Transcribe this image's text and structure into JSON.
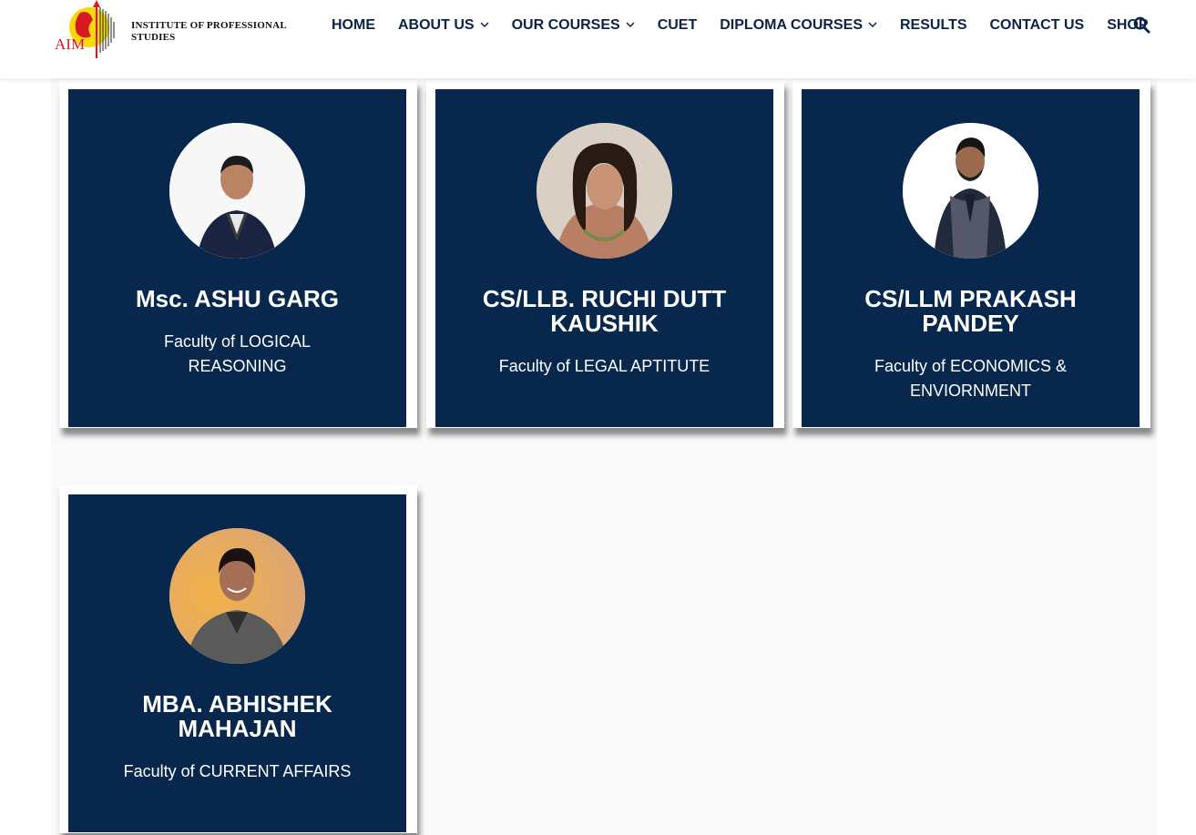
{
  "brand": {
    "logo_text": "AIM",
    "name_line1": "INSTITUTE OF PROFESSIONAL",
    "name_line2": "STUDIES"
  },
  "nav": {
    "items": [
      {
        "label": "HOME",
        "has_dropdown": false
      },
      {
        "label": "ABOUT US",
        "has_dropdown": true
      },
      {
        "label": "OUR COURSES",
        "has_dropdown": true
      },
      {
        "label": "CUET",
        "has_dropdown": false
      },
      {
        "label": "DIPLOMA COURSES",
        "has_dropdown": true
      },
      {
        "label": "RESULTS",
        "has_dropdown": false
      },
      {
        "label": "CONTACT US",
        "has_dropdown": false
      },
      {
        "label": "SHOP",
        "has_dropdown": false
      }
    ],
    "search_icon": "search-icon"
  },
  "colors": {
    "card_bg": "#08274d",
    "nav_text": "#0b2347",
    "logo_red": "#d71920",
    "logo_yellow": "#f5d90a"
  },
  "faculty": [
    {
      "name": "Msc. ASHU GARG",
      "role": "Faculty of LOGICAL REASONING"
    },
    {
      "name": "CS/LLB. RUCHI DUTT KAUSHIK",
      "role": "Faculty of LEGAL APTITUTE"
    },
    {
      "name": "CS/LLM PRAKASH PANDEY",
      "role": "Faculty of ECONOMICS & ENVIORNMENT"
    },
    {
      "name": "MBA. ABHISHEK MAHAJAN",
      "role": "Faculty of CURRENT AFFAIRS"
    }
  ]
}
